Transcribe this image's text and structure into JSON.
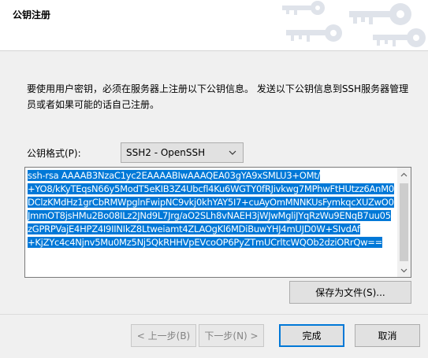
{
  "dialog": {
    "title": "公钥注册"
  },
  "description": "要使用用户密钥，必须在服务器上注册以下公钥信息。 发送以下公钥信息到SSH服务器管理员或者如果可能的话自己注册。",
  "format": {
    "label": "公钥格式(P):",
    "selected": "SSH2 - OpenSSH",
    "icon": "chevron-down-icon"
  },
  "key": {
    "text": "ssh-rsa AAAAB3NzaC1yc2EAAAABIwAAAQEA03gYA9xSMLU3+OMt/\n+YO8/kKyTEqsN66y5ModT5eKIB3Z4Ubcfl4Ku6WGTY0fRJivkwg7MPhwFtHUtzz6AnM0DClzKMdHz1grCbRMWpglnFwipNC9vkj0khYAY5I7+cuAyOmMNNKUsFymkqcXUZwO0JmmOT8jsHMu2Bo08ILz2JNd9L7Jrg/aO2SLh8vNAEH3jWJwMgliJYqRzWu9ENqB7uu05zGPRPVajE4HPZ4I9IINIkZ8Ltweiamt4ZLAOgKl6MDiBuwYHJ4mUJD0W+SIvdAf\n+KjZYc4c4Njnv5Mu0Mz5Nj5QkRHHVpEVcoOP6PyZTmUCrltcWQOb2dziORrQw=="
  },
  "buttons": {
    "save": "保存为文件(S)...",
    "back": "< 上一步(B)",
    "next": "下一步(N) >",
    "finish": "完成",
    "cancel": "取消"
  },
  "colors": {
    "selection": "#0078d7",
    "header_bg": "#ffffff",
    "dialog_bg": "#f0f0f0"
  }
}
